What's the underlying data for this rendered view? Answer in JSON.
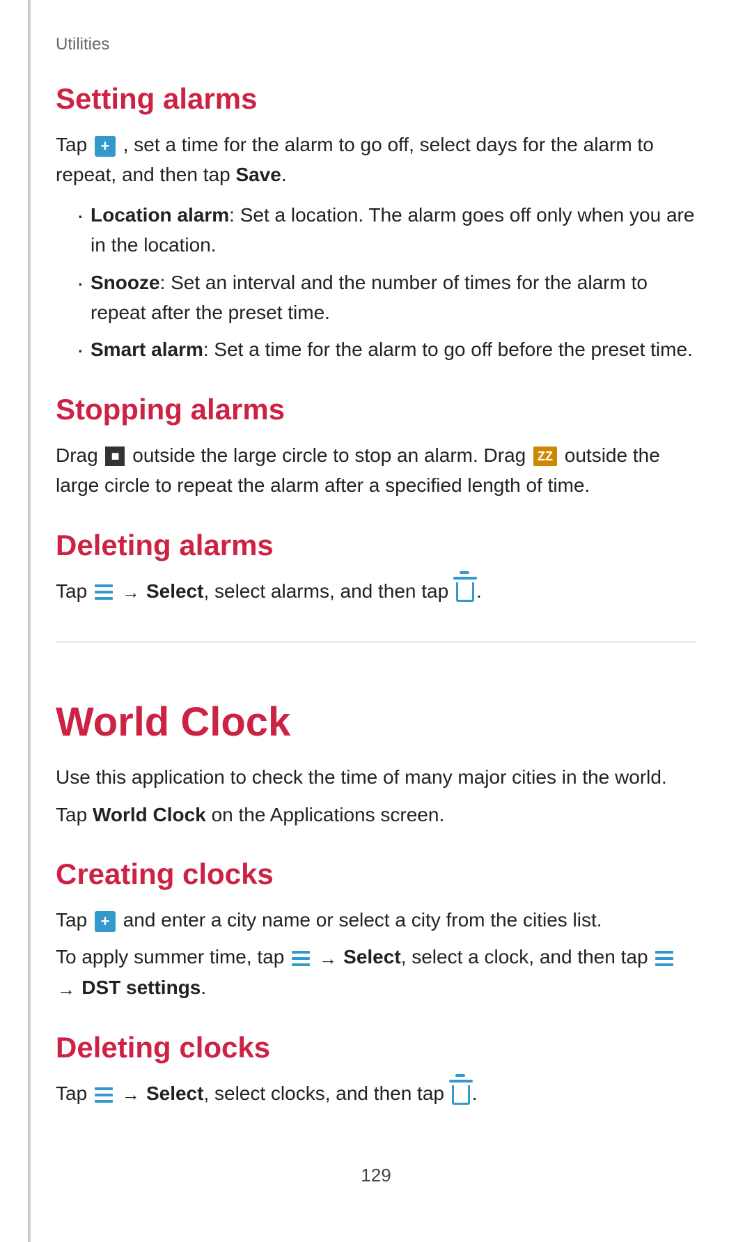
{
  "utilities_label": "Utilities",
  "setting_alarms": {
    "heading": "Setting alarms",
    "intro": "Tap",
    "intro_after": ", set a time for the alarm to go off, select days for the alarm to repeat, and then tap",
    "save_bold": "Save",
    "intro_end": ".",
    "bullets": [
      {
        "term": "Location alarm",
        "desc": ": Set a location. The alarm goes off only when you are in the location."
      },
      {
        "term": "Snooze",
        "desc": ": Set an interval and the number of times for the alarm to repeat after the preset time."
      },
      {
        "term": "Smart alarm",
        "desc": ": Set a time for the alarm to go off before the preset time."
      }
    ]
  },
  "stopping_alarms": {
    "heading": "Stopping alarms",
    "text_before_stop": "Drag",
    "text_after_stop": "outside the large circle to stop an alarm. Drag",
    "text_after_zz": "outside the large circle to repeat the alarm after a specified length of time."
  },
  "deleting_alarms": {
    "heading": "Deleting alarms",
    "text_before_menu": "Tap",
    "arrow": "→",
    "select_bold": "Select",
    "text_after_select": ", select alarms, and then tap",
    "text_end": "."
  },
  "world_clock": {
    "heading": "World Clock",
    "desc1": "Use this application to check the time of many major cities in the world.",
    "desc2_before": "Tap",
    "desc2_bold": "World Clock",
    "desc2_after": "on the Applications screen."
  },
  "creating_clocks": {
    "heading": "Creating clocks",
    "text1_before": "Tap",
    "text1_after": "and enter a city name or select a city from the cities list.",
    "text2_before": "To apply summer time, tap",
    "text2_arrow1": "→",
    "text2_select": "Select",
    "text2_middle": ", select a clock, and then tap",
    "text2_arrow2": "→",
    "text2_dst": "DST settings",
    "text2_end": "."
  },
  "deleting_clocks": {
    "heading": "Deleting clocks",
    "text_before": "Tap",
    "arrow": "→",
    "select_bold": "Select",
    "text_after": ", select clocks, and then tap",
    "text_end": "."
  },
  "page_number": "129"
}
